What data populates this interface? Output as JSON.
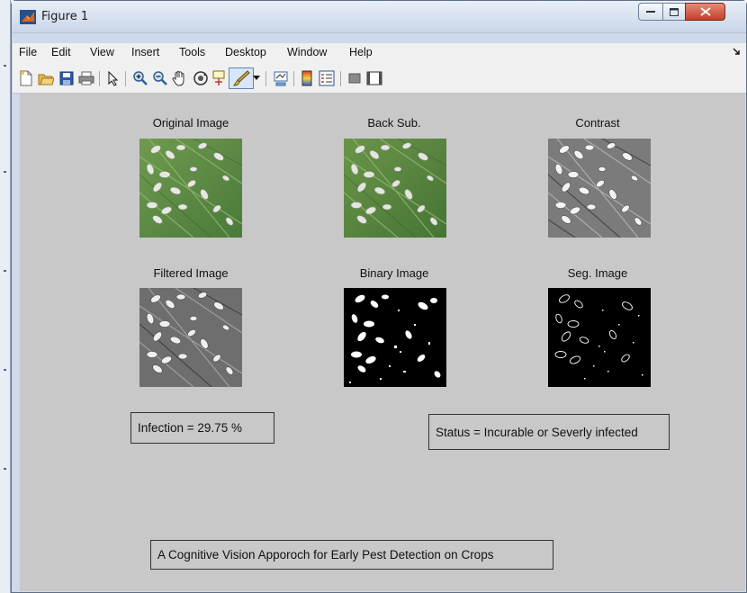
{
  "window": {
    "title": "Figure 1"
  },
  "menu": {
    "items": [
      "File",
      "Edit",
      "View",
      "Insert",
      "Tools",
      "Desktop",
      "Window",
      "Help"
    ]
  },
  "toolbar": {
    "icons": [
      "new-figure-icon",
      "open-file-icon",
      "save-icon",
      "print-icon",
      "select-arrow-icon",
      "zoom-in-icon",
      "zoom-out-icon",
      "pan-hand-icon",
      "rotate-3d-icon",
      "data-cursor-icon",
      "brush-icon",
      "brush-dropdown-icon",
      "link-plot-icon",
      "insert-colorbar-icon",
      "insert-legend-icon",
      "hide-plot-tools-icon",
      "show-plot-tools-icon"
    ]
  },
  "panels": {
    "original": {
      "title": "Original Image"
    },
    "backsub": {
      "title": "Back Sub."
    },
    "contrast": {
      "title": "Contrast"
    },
    "filtered": {
      "title": "Filtered Image"
    },
    "binary": {
      "title": "Binary Image"
    },
    "seg": {
      "title": "Seg. Image"
    }
  },
  "results": {
    "infection": "Infection = 29.75 %",
    "status": "Status = Incurable or Severly infected"
  },
  "footer": {
    "caption": "A Cognitive Vision Apporoch for Early Pest Detection on Crops"
  },
  "colors": {
    "figure_bg": "#c8c8c8",
    "leaf_green": "#5f8a45",
    "title_close": "#c1402c"
  }
}
